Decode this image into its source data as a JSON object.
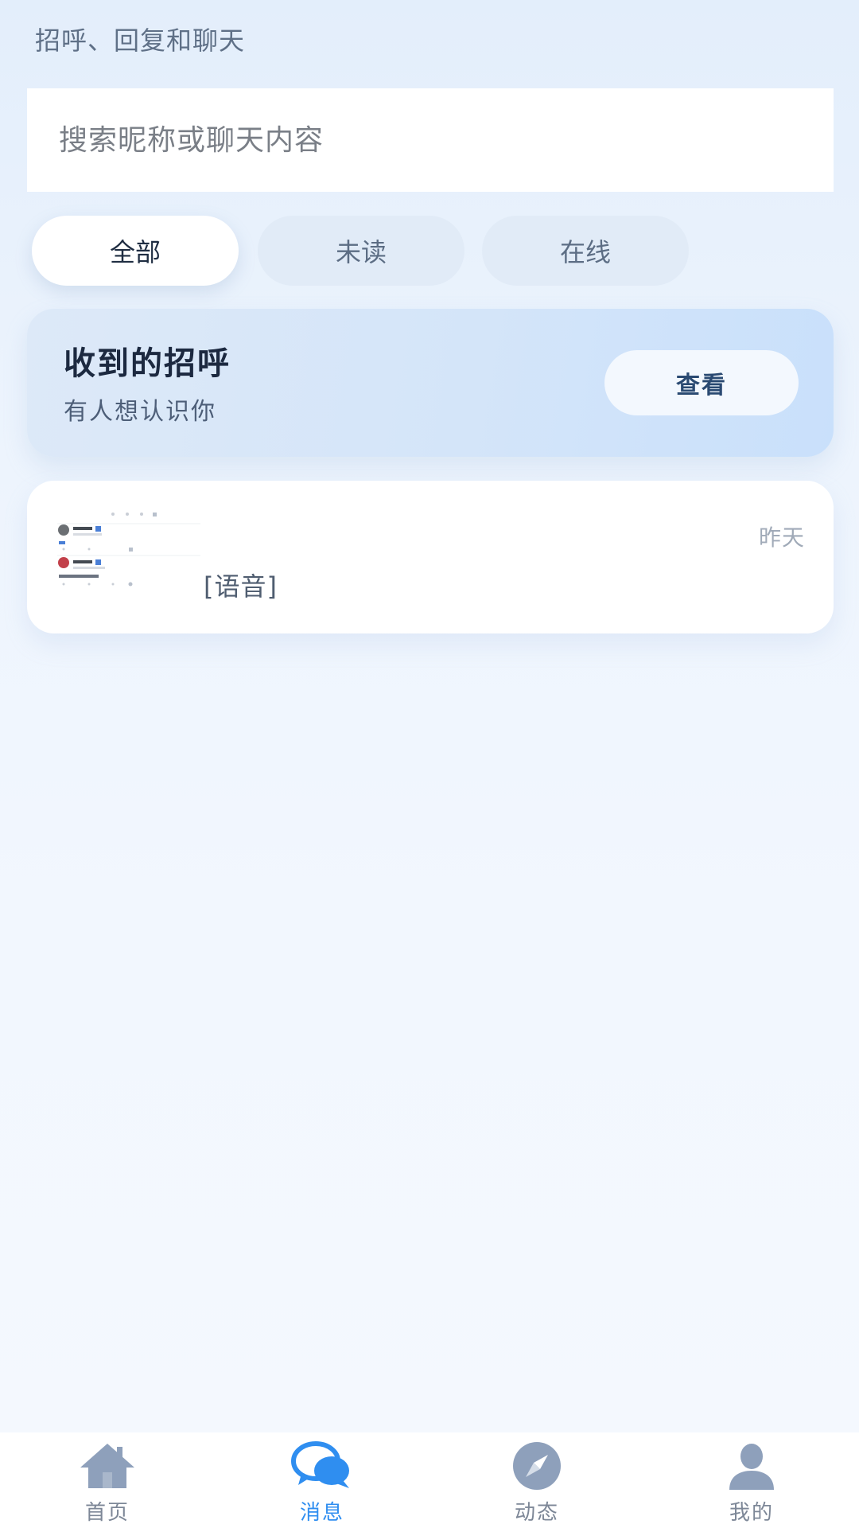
{
  "header": {
    "subtitle": "招呼、回复和聊天"
  },
  "search": {
    "placeholder": "搜索昵称或聊天内容",
    "value": ""
  },
  "filters": {
    "tabs": [
      {
        "label": "全部",
        "active": true
      },
      {
        "label": "未读",
        "active": false
      },
      {
        "label": "在线",
        "active": false
      }
    ]
  },
  "greeting_card": {
    "title": "收到的招呼",
    "subtitle": "有人想认识你",
    "button_label": "查看"
  },
  "conversations": [
    {
      "name": "",
      "preview": "[语音]",
      "time": "昨天",
      "avatar": "screenshot-thumbnail"
    }
  ],
  "bottom_nav": {
    "items": [
      {
        "label": "首页",
        "icon": "home-icon",
        "active": false
      },
      {
        "label": "消息",
        "icon": "chat-bubbles-icon",
        "active": true
      },
      {
        "label": "动态",
        "icon": "compass-icon",
        "active": false
      },
      {
        "label": "我的",
        "icon": "user-icon",
        "active": false
      }
    ]
  },
  "colors": {
    "accent": "#2f8ef0",
    "nav_inactive": "#7d8797",
    "icon_inactive": "#8ea0bb"
  }
}
